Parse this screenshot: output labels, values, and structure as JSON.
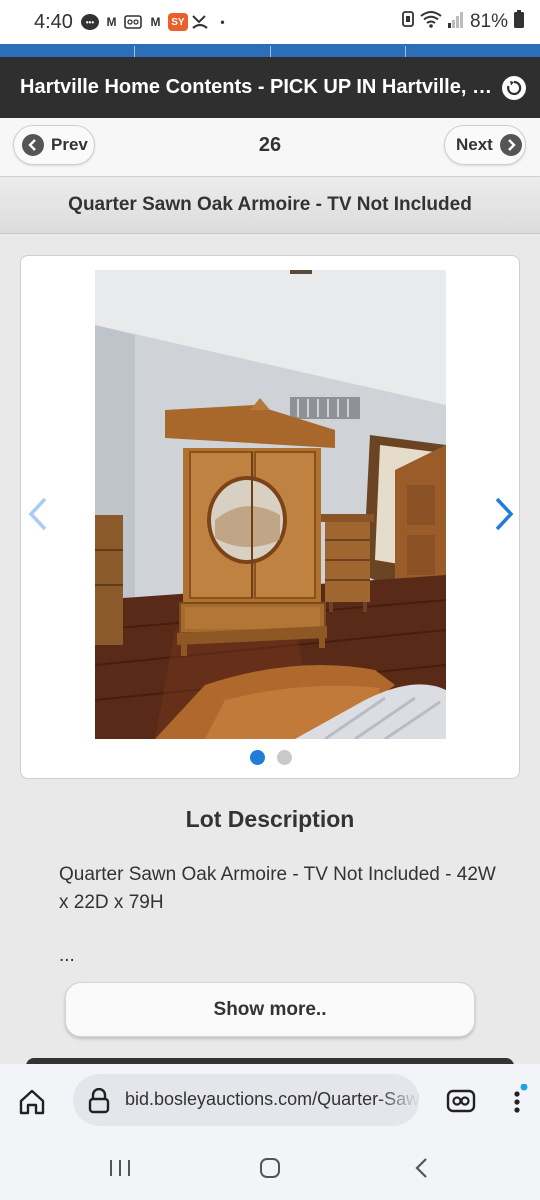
{
  "status_bar": {
    "time": "4:40",
    "battery": "81%",
    "notification_icons": [
      "message-bubble-icon",
      "gmail-icon",
      "voicemail-icon",
      "gmail-icon",
      "sy-app-icon",
      "missed-call-icon"
    ]
  },
  "header": {
    "title": "Hartville Home Contents - PICK UP IN Hartville, OH"
  },
  "pager": {
    "prev_label": "Prev",
    "page_number": "26",
    "next_label": "Next"
  },
  "lot": {
    "title": "Quarter Sawn Oak Armoire - TV Not Included"
  },
  "carousel": {
    "image_count": 2,
    "active_index": 0
  },
  "description": {
    "heading": "Lot Description",
    "text": "Quarter Sawn Oak Armoire - TV Not Included - 42W x 22D x 79H",
    "ellipsis": "...",
    "show_more_label": "Show more.."
  },
  "browser": {
    "url": "bid.bosleyauctions.com/Quarter-Sawn-Oak-Armoire"
  },
  "colors": {
    "header_bg": "#2f2f2f",
    "nav_strip": "#2a6fb8",
    "accent_blue": "#1f7cd9",
    "page_bg": "#e9e9e9"
  }
}
